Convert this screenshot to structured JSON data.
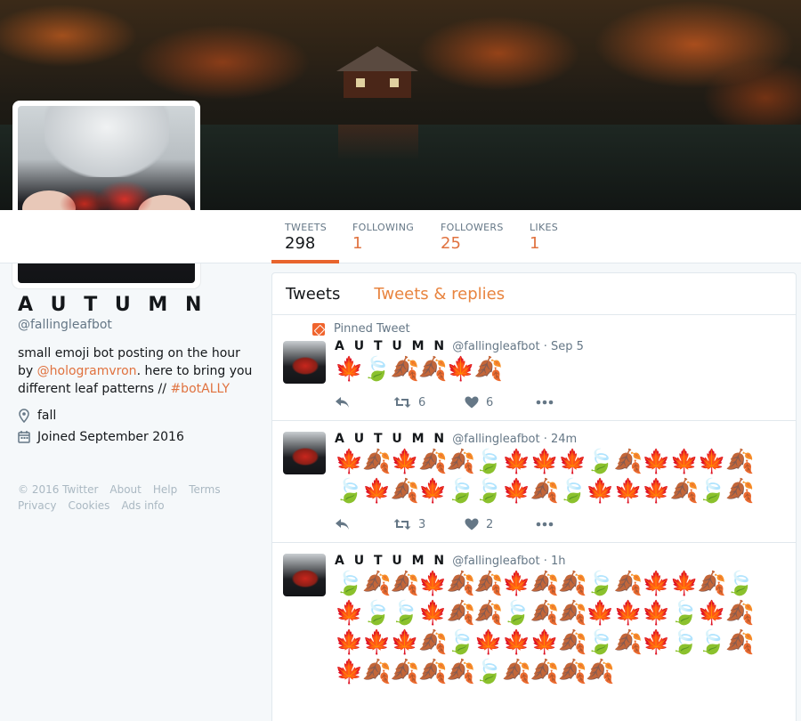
{
  "profile": {
    "name": "A U T U M N",
    "handle": "@fallingleafbot",
    "bio_start": "small emoji bot posting on the hour by ",
    "bio_link": "@hologramvron",
    "bio_mid": ". here to bring you different leaf patterns // ",
    "bio_tag": "#botALLY",
    "location": "fall",
    "joined": "Joined September 2016"
  },
  "stats": [
    {
      "label": "TWEETS",
      "value": "298"
    },
    {
      "label": "FOLLOWING",
      "value": "1"
    },
    {
      "label": "FOLLOWERS",
      "value": "25"
    },
    {
      "label": "LIKES",
      "value": "1"
    }
  ],
  "footer": [
    "© 2016 Twitter",
    "About",
    "Help",
    "Terms",
    "Privacy",
    "Cookies",
    "Ads info"
  ],
  "tabs": [
    "Tweets",
    "Tweets & replies"
  ],
  "pinned_label": "Pinned Tweet",
  "tweets": [
    {
      "name": "A U T U M N",
      "handle": "@fallingleafbot",
      "time": "· Sep 5",
      "text": "🍁🍃🍂🍂🍁🍂",
      "retweets": "6",
      "likes": "6"
    },
    {
      "name": "A U T U M N",
      "handle": "@fallingleafbot",
      "time": "· 24m",
      "text": "🍁🍂🍁🍂🍂🍃🍁🍁🍁🍃🍂🍁🍁🍁🍂🍃🍁🍂🍁🍃🍃🍁🍂🍃🍁🍁🍁🍂🍃🍂",
      "retweets": "3",
      "likes": "2"
    },
    {
      "name": "A U T U M N",
      "handle": "@fallingleafbot",
      "time": "· 1h",
      "text": "🍃🍂🍂🍁🍂🍂🍁🍂🍂🍃🍂🍁🍁🍂🍃🍁🍃🍃🍁🍂🍂🍃🍂🍂🍁🍁🍁🍃🍁🍂🍁🍁🍁🍂🍃🍁🍁🍁🍂🍃🍂🍁🍃🍃🍂🍁🍂🍂🍂🍂🍃🍂🍂🍂🍂"
    }
  ],
  "colors": {
    "accent": "#e0723f",
    "tab_underline": "#e8642d",
    "pin": "#f0642d"
  }
}
